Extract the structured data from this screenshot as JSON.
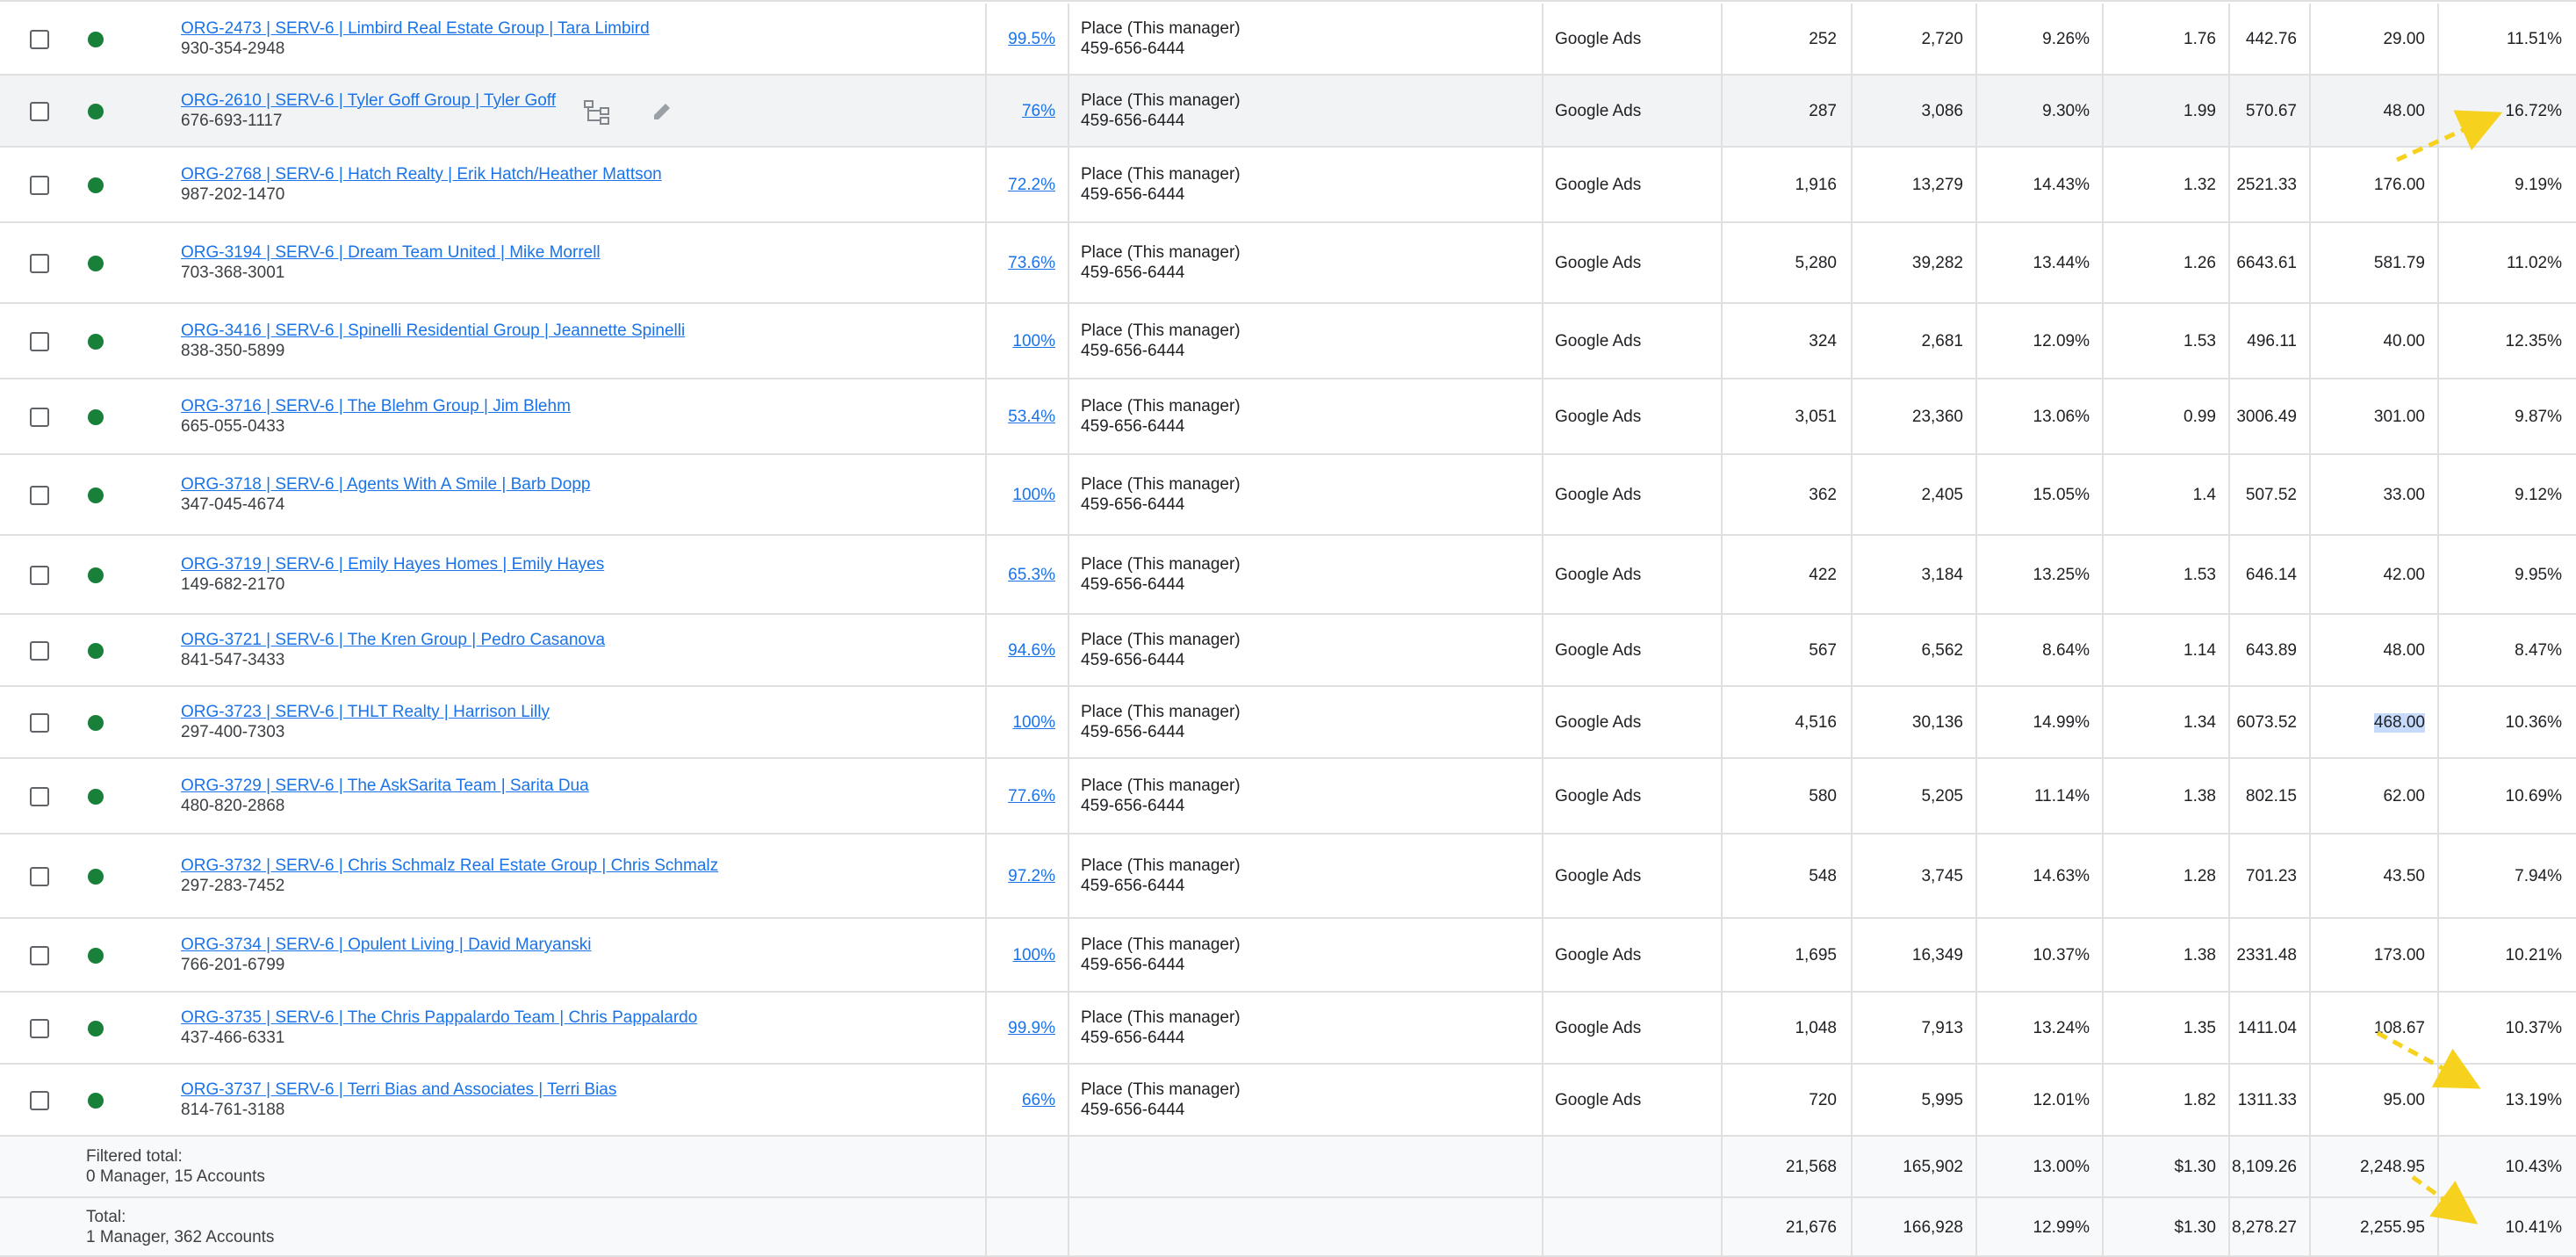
{
  "manager_line1": "Place (This manager)",
  "manager_line2": "459-656-6444",
  "rows": [
    {
      "account": "ORG-2473 | SERV-6 | Limbird Real Estate Group | Tara Limbird",
      "phone": "930-354-2948",
      "opt": "99.5%",
      "channel": "Google Ads",
      "c1": "252",
      "c2": "2,720",
      "c3": "9.26%",
      "c4": "1.76",
      "c5": "442.76",
      "c6": "29.00",
      "c7": "11.51%"
    },
    {
      "account": "ORG-2610 | SERV-6 | Tyler Goff Group | Tyler Goff",
      "phone": "676-693-1117",
      "opt": "76%",
      "channel": "Google Ads",
      "c1": "287",
      "c2": "3,086",
      "c3": "9.30%",
      "c4": "1.99",
      "c5": "570.67",
      "c6": "48.00",
      "c7": "16.72%"
    },
    {
      "account": "ORG-2768 | SERV-6 | Hatch Realty | Erik Hatch/Heather Mattson",
      "phone": "987-202-1470",
      "opt": "72.2%",
      "channel": "Google Ads",
      "c1": "1,916",
      "c2": "13,279",
      "c3": "14.43%",
      "c4": "1.32",
      "c5": "2521.33",
      "c6": "176.00",
      "c7": "9.19%"
    },
    {
      "account": "ORG-3194 | SERV-6 | Dream Team United | Mike Morrell",
      "phone": "703-368-3001",
      "opt": "73.6%",
      "channel": "Google Ads",
      "c1": "5,280",
      "c2": "39,282",
      "c3": "13.44%",
      "c4": "1.26",
      "c5": "6643.61",
      "c6": "581.79",
      "c7": "11.02%"
    },
    {
      "account": "ORG-3416 | SERV-6 | Spinelli Residential Group | Jeannette Spinelli",
      "phone": "838-350-5899",
      "opt": "100%",
      "channel": "Google Ads",
      "c1": "324",
      "c2": "2,681",
      "c3": "12.09%",
      "c4": "1.53",
      "c5": "496.11",
      "c6": "40.00",
      "c7": "12.35%"
    },
    {
      "account": "ORG-3716 | SERV-6 | The Blehm Group | Jim Blehm",
      "phone": "665-055-0433",
      "opt": "53.4%",
      "channel": "Google Ads",
      "c1": "3,051",
      "c2": "23,360",
      "c3": "13.06%",
      "c4": "0.99",
      "c5": "3006.49",
      "c6": "301.00",
      "c7": "9.87%"
    },
    {
      "account": "ORG-3718 | SERV-6 | Agents With A Smile | Barb Dopp",
      "phone": "347-045-4674",
      "opt": "100%",
      "channel": "Google Ads",
      "c1": "362",
      "c2": "2,405",
      "c3": "15.05%",
      "c4": "1.4",
      "c5": "507.52",
      "c6": "33.00",
      "c7": "9.12%"
    },
    {
      "account": "ORG-3719 | SERV-6 | Emily Hayes Homes | Emily Hayes",
      "phone": "149-682-2170",
      "opt": "65.3%",
      "channel": "Google Ads",
      "c1": "422",
      "c2": "3,184",
      "c3": "13.25%",
      "c4": "1.53",
      "c5": "646.14",
      "c6": "42.00",
      "c7": "9.95%"
    },
    {
      "account": "ORG-3721 | SERV-6 | The Kren Group | Pedro Casanova",
      "phone": "841-547-3433",
      "opt": "94.6%",
      "channel": "Google Ads",
      "c1": "567",
      "c2": "6,562",
      "c3": "8.64%",
      "c4": "1.14",
      "c5": "643.89",
      "c6": "48.00",
      "c7": "8.47%"
    },
    {
      "account": "ORG-3723 | SERV-6 | THLT Realty | Harrison Lilly",
      "phone": "297-400-7303",
      "opt": "100%",
      "channel": "Google Ads",
      "c1": "4,516",
      "c2": "30,136",
      "c3": "14.99%",
      "c4": "1.34",
      "c5": "6073.52",
      "c6": "468.00",
      "c7": "10.36%"
    },
    {
      "account": "ORG-3729 | SERV-6 | The AskSarita Team | Sarita Dua",
      "phone": "480-820-2868",
      "opt": "77.6%",
      "channel": "Google Ads",
      "c1": "580",
      "c2": "5,205",
      "c3": "11.14%",
      "c4": "1.38",
      "c5": "802.15",
      "c6": "62.00",
      "c7": "10.69%"
    },
    {
      "account": "ORG-3732 | SERV-6 | Chris Schmalz Real Estate Group | Chris Schmalz",
      "phone": "297-283-7452",
      "opt": "97.2%",
      "channel": "Google Ads",
      "c1": "548",
      "c2": "3,745",
      "c3": "14.63%",
      "c4": "1.28",
      "c5": "701.23",
      "c6": "43.50",
      "c7": "7.94%"
    },
    {
      "account": "ORG-3734 | SERV-6 | Opulent Living | David Maryanski",
      "phone": "766-201-6799",
      "opt": "100%",
      "channel": "Google Ads",
      "c1": "1,695",
      "c2": "16,349",
      "c3": "10.37%",
      "c4": "1.38",
      "c5": "2331.48",
      "c6": "173.00",
      "c7": "10.21%"
    },
    {
      "account": "ORG-3735 | SERV-6 | The Chris Pappalardo Team | Chris Pappalardo",
      "phone": "437-466-6331",
      "opt": "99.9%",
      "channel": "Google Ads",
      "c1": "1,048",
      "c2": "7,913",
      "c3": "13.24%",
      "c4": "1.35",
      "c5": "1411.04",
      "c6": "108.67",
      "c7": "10.37%"
    },
    {
      "account": "ORG-3737 | SERV-6 | Terri Bias and Associates | Terri Bias",
      "phone": "814-761-3188",
      "opt": "66%",
      "channel": "Google Ads",
      "c1": "720",
      "c2": "5,995",
      "c3": "12.01%",
      "c4": "1.82",
      "c5": "1311.33",
      "c6": "95.00",
      "c7": "13.19%"
    }
  ],
  "filtered_total": {
    "label": "Filtered total:",
    "sub": "0 Manager, 15 Accounts",
    "c1": "21,568",
    "c2": "165,902",
    "c3": "13.00%",
    "c4": "$1.30",
    "c5": "8,109.26",
    "c6": "2,248.95",
    "c7": "10.43%"
  },
  "total": {
    "label": "Total:",
    "sub": "1 Manager, 362 Accounts",
    "c1": "21,676",
    "c2": "166,928",
    "c3": "12.99%",
    "c4": "$1.30",
    "c5": "8,278.27",
    "c6": "2,255.95",
    "c7": "10.41%"
  },
  "icons": {
    "structure": "account-structure-icon",
    "edit": "pencil-edit-icon"
  },
  "colors": {
    "link": "#1a73e8",
    "status_green": "#188038",
    "annotation_arrow": "#f6d21e",
    "selection": "#c6dafc"
  }
}
